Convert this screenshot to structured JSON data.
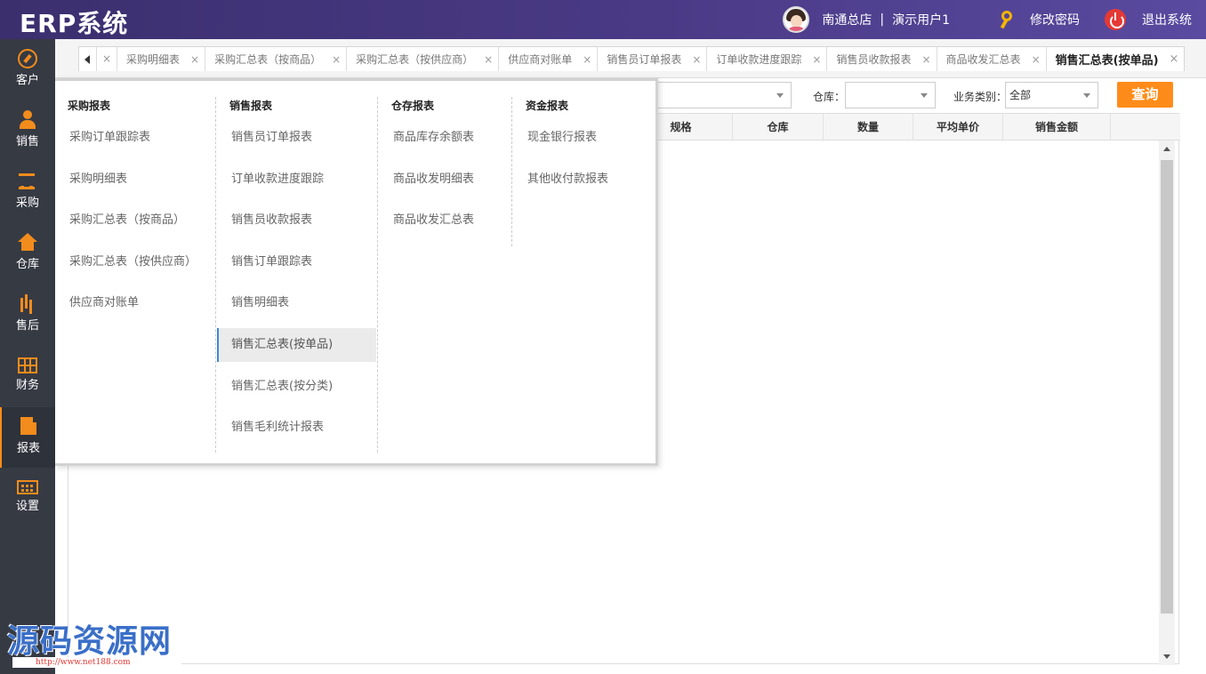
{
  "app": {
    "title": "ERP系统"
  },
  "header": {
    "store": "南通总店",
    "separator": "|",
    "user": "演示用户1",
    "change_password": "修改密码",
    "logout": "退出系统"
  },
  "sidebar": {
    "items": [
      {
        "label": "客户",
        "icon": "compass-icon"
      },
      {
        "label": "销售",
        "icon": "user-icon"
      },
      {
        "label": "采购",
        "icon": "cart-icon"
      },
      {
        "label": "仓库",
        "icon": "house-icon"
      },
      {
        "label": "售后",
        "icon": "bars-icon"
      },
      {
        "label": "财务",
        "icon": "grid-icon"
      },
      {
        "label": "报表",
        "icon": "document-icon",
        "active": true
      },
      {
        "label": "设置",
        "icon": "screen-icon"
      }
    ]
  },
  "tabs": [
    {
      "label": "采购明细表"
    },
    {
      "label": "采购汇总表（按商品）"
    },
    {
      "label": "采购汇总表（按供应商）"
    },
    {
      "label": "供应商对账单"
    },
    {
      "label": "销售员订单报表"
    },
    {
      "label": "订单收款进度跟踪"
    },
    {
      "label": "销售员收款报表"
    },
    {
      "label": "商品收发汇总表"
    },
    {
      "label": "销售汇总表(按单品)",
      "active": true
    }
  ],
  "tab_close": "×",
  "filter": {
    "warehouse_label": "仓库：",
    "biz_type_label": "业务类别：",
    "biz_type_value": "全部",
    "query_button": "查询"
  },
  "grid": {
    "columns": [
      "规格",
      "仓库",
      "数量",
      "平均单价",
      "销售金额"
    ]
  },
  "menu": {
    "columns": [
      {
        "title": "采购报表",
        "items": [
          "采购订单跟踪表",
          "采购明细表",
          "采购汇总表（按商品）",
          "采购汇总表（按供应商）",
          "供应商对账单"
        ]
      },
      {
        "title": "销售报表",
        "items": [
          "销售员订单报表",
          "订单收款进度跟踪",
          "销售员收款报表",
          "销售订单跟踪表",
          "销售明细表",
          "销售汇总表(按单品)",
          "销售汇总表(按分类)",
          "销售毛利统计报表"
        ],
        "selected_index": 5
      },
      {
        "title": "仓存报表",
        "items": [
          "商品库存余额表",
          "商品收发明细表",
          "商品收发汇总表"
        ]
      },
      {
        "title": "资金报表",
        "items": [
          "现金银行报表",
          "其他收付款报表"
        ]
      }
    ]
  },
  "watermark": {
    "text": "源码资源网",
    "url": "http://www.net188.com"
  },
  "colors": {
    "header_bg": "#4a3a86",
    "sidebar_bg": "#363a43",
    "accent": "#ff8c1a",
    "selected_bar": "#3f87d6"
  }
}
